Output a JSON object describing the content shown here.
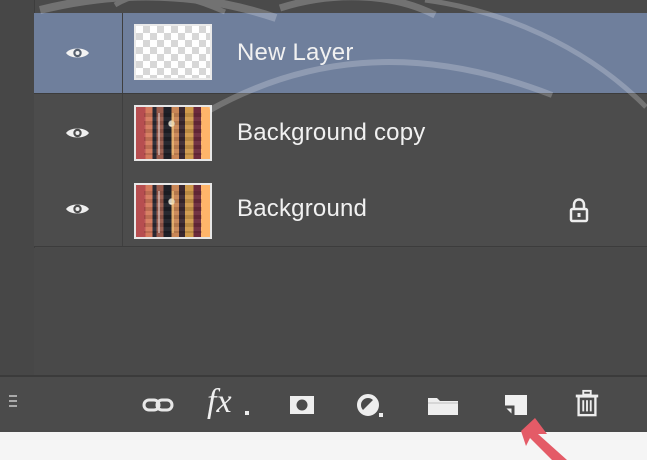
{
  "panel": {
    "layers": [
      {
        "name": "New Layer",
        "selected": true,
        "thumbnail": "transparent-checkerboard",
        "visibility_icon": "eye-icon",
        "locked": false
      },
      {
        "name": "Background copy",
        "selected": false,
        "thumbnail": "image-thumbnail",
        "visibility_icon": "eye-icon",
        "locked": false
      },
      {
        "name": "Background",
        "selected": false,
        "thumbnail": "image-thumbnail",
        "visibility_icon": "eye-icon",
        "locked": true,
        "lock_icon": "lock-icon"
      }
    ],
    "footer": {
      "icons": [
        "panel-menu-icon",
        "link-icon",
        "fx-icon",
        "layer-mask-icon",
        "adjustment-layer-icon",
        "folder-icon",
        "new-layer-icon",
        "trash-icon"
      ],
      "fx_label": "fx"
    }
  },
  "colors": {
    "panel_background": "#4a4a4a",
    "selected_row": "#6f7f9c",
    "text": "#f1f1f1",
    "arrow": "#e45b67"
  }
}
